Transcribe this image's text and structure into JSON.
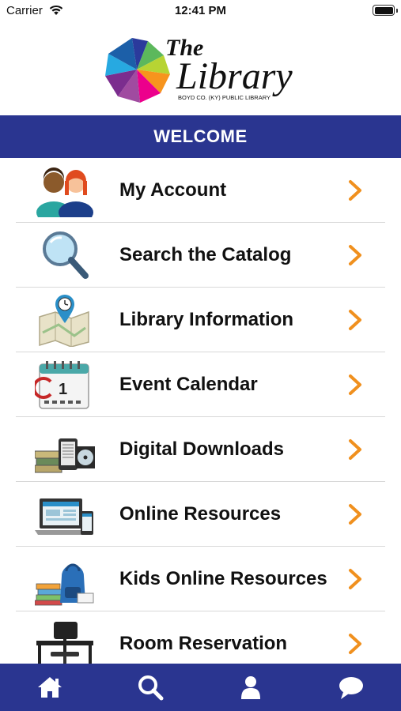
{
  "status_bar": {
    "carrier": "Carrier",
    "time": "12:41 PM",
    "wifi_icon": "wifi-icon",
    "battery_icon": "battery-icon"
  },
  "header": {
    "logo_the": "The",
    "logo_library": "Library",
    "logo_subtitle": "BOYD CO. (KY) PUBLIC LIBRARY"
  },
  "welcome": {
    "title": "WELCOME"
  },
  "menu": {
    "items": [
      {
        "label": "My Account",
        "icon": "users-icon"
      },
      {
        "label": "Search the Catalog",
        "icon": "magnifier-icon"
      },
      {
        "label": "Library Information",
        "icon": "map-pin-icon"
      },
      {
        "label": "Event Calendar",
        "icon": "calendar-icon"
      },
      {
        "label": "Digital Downloads",
        "icon": "devices-icon"
      },
      {
        "label": "Online Resources",
        "icon": "laptop-icon"
      },
      {
        "label": "Kids Online Resources",
        "icon": "backpack-icon"
      },
      {
        "label": "Room Reservation",
        "icon": "desk-icon"
      }
    ]
  },
  "tab_bar": {
    "tabs": [
      {
        "icon": "home-icon"
      },
      {
        "icon": "search-icon"
      },
      {
        "icon": "person-icon"
      },
      {
        "icon": "chat-icon"
      }
    ]
  },
  "colors": {
    "brand_blue": "#2a3590",
    "chevron_orange": "#f0901e",
    "divider": "#d8d8d8"
  }
}
